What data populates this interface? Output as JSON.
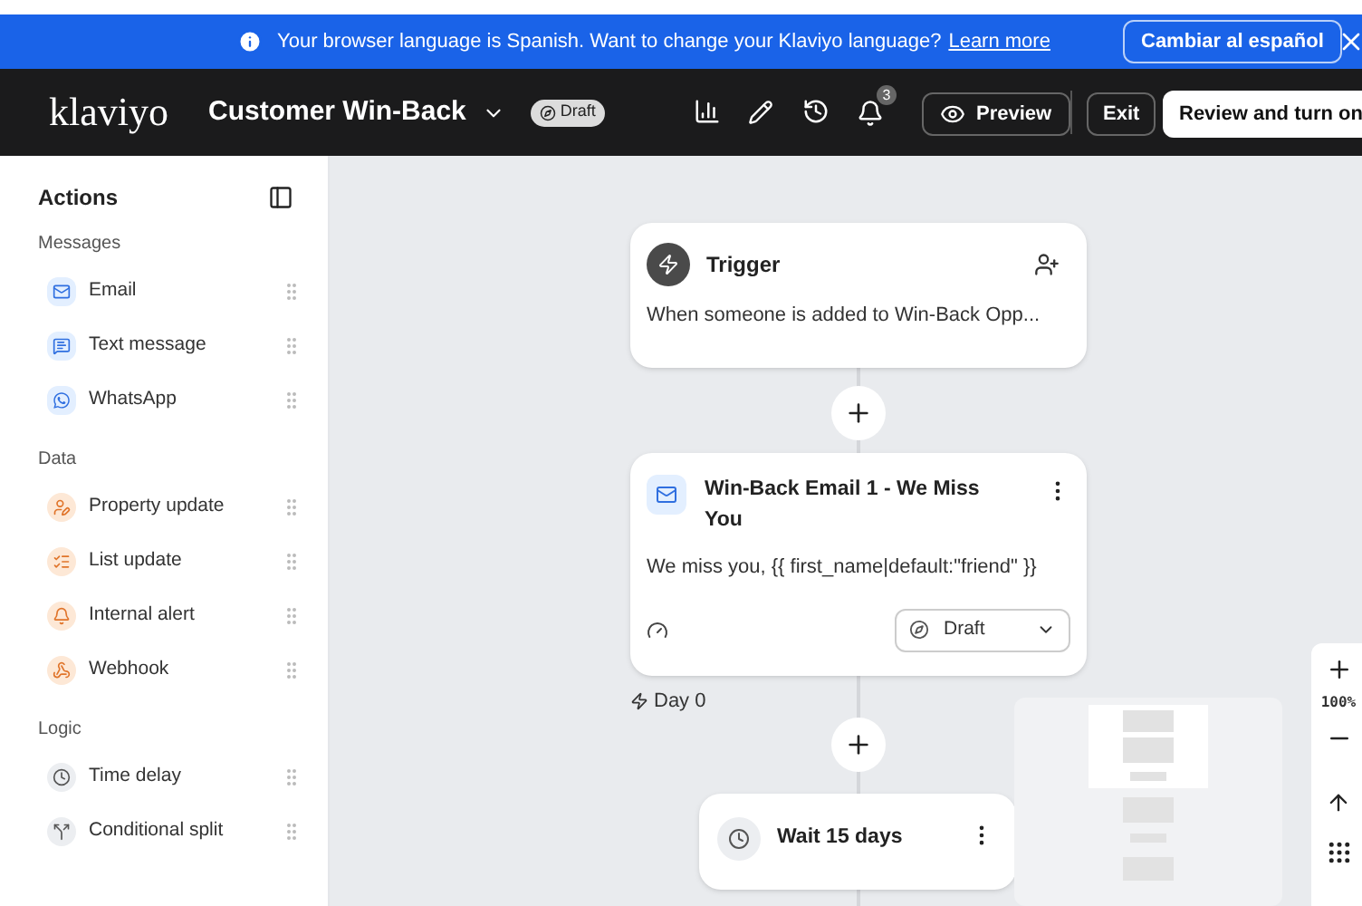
{
  "banner": {
    "message": "Your browser language is Spanish. Want to change your Klaviyo language?",
    "link": "Learn more",
    "button": "Cambiar al español"
  },
  "header": {
    "logo": "klaviyo",
    "flow_name": "Customer Win-Back",
    "status": "Draft",
    "notification_count": "3",
    "preview": "Preview",
    "exit": "Exit",
    "primary": "Review and turn on"
  },
  "sidebar": {
    "title": "Actions",
    "groups": [
      {
        "label": "Messages",
        "kind": "message",
        "items": [
          "Email",
          "Text message",
          "WhatsApp"
        ]
      },
      {
        "label": "Data",
        "kind": "data",
        "items": [
          "Property update",
          "List update",
          "Internal alert",
          "Webhook"
        ]
      },
      {
        "label": "Logic",
        "kind": "logic",
        "items": [
          "Time delay",
          "Conditional split"
        ]
      }
    ]
  },
  "canvas": {
    "trigger": {
      "title": "Trigger",
      "description": "When someone is added to Win-Back Opp..."
    },
    "email": {
      "title": "Win-Back Email 1 - We Miss You",
      "body": "We miss you, {{ first_name|default:\"friend\" }}",
      "status": "Draft"
    },
    "day_label": "Day 0",
    "wait": {
      "title": "Wait 15 days"
    },
    "zoom": "100%"
  }
}
